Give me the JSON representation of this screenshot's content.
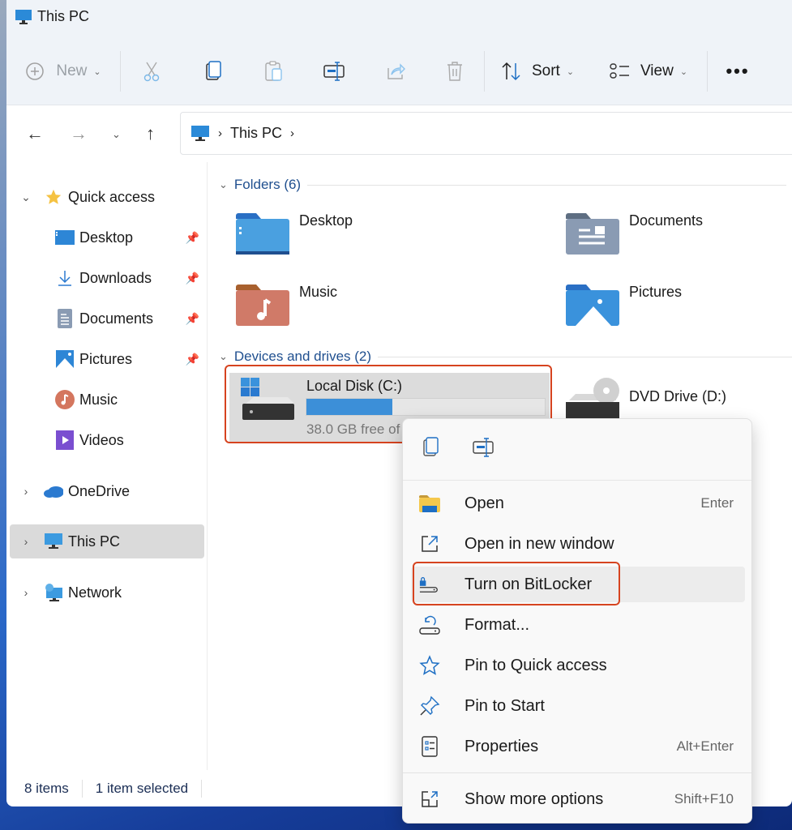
{
  "window": {
    "title": "This PC"
  },
  "toolbar": {
    "new_label": "New",
    "sort_label": "Sort",
    "view_label": "View",
    "icons": [
      "plus-circle-icon",
      "cut-icon",
      "copy-icon",
      "paste-icon",
      "rename-icon",
      "share-icon",
      "delete-icon",
      "sort-icon",
      "view-icon",
      "more-icon"
    ]
  },
  "nav": {
    "breadcrumb": [
      "This PC"
    ]
  },
  "sidebar": {
    "quick_access": "Quick access",
    "items": [
      {
        "label": "Desktop",
        "pinned": true
      },
      {
        "label": "Downloads",
        "pinned": true
      },
      {
        "label": "Documents",
        "pinned": true
      },
      {
        "label": "Pictures",
        "pinned": true
      },
      {
        "label": "Music",
        "pinned": false
      },
      {
        "label": "Videos",
        "pinned": false
      }
    ],
    "onedrive": "OneDrive",
    "this_pc": "This PC",
    "network": "Network"
  },
  "content": {
    "folders_header": "Folders (6)",
    "folders": [
      {
        "label": "Desktop"
      },
      {
        "label": "Documents"
      },
      {
        "label": "Music"
      },
      {
        "label": "Pictures"
      }
    ],
    "devices_header": "Devices and drives (2)",
    "drives": [
      {
        "label": "Local Disk (C:)",
        "free_text": "38.0 GB free of",
        "used_fraction": 0.36
      },
      {
        "label": "DVD Drive (D:)"
      }
    ]
  },
  "status": {
    "items": "8 items",
    "selected": "1 item selected"
  },
  "context_menu": {
    "top_icons": [
      "copy-icon",
      "rename-icon"
    ],
    "items": [
      {
        "label": "Open",
        "shortcut": "Enter"
      },
      {
        "label": "Open in new window",
        "shortcut": ""
      },
      {
        "label": "Turn on BitLocker",
        "shortcut": ""
      },
      {
        "label": "Format...",
        "shortcut": ""
      },
      {
        "label": "Pin to Quick access",
        "shortcut": ""
      },
      {
        "label": "Pin to Start",
        "shortcut": ""
      },
      {
        "label": "Properties",
        "shortcut": "Alt+Enter"
      },
      {
        "label": "Show more options",
        "shortcut": "Shift+F10"
      }
    ]
  },
  "colors": {
    "accent": "#0067c0",
    "highlight_box": "#d6431f",
    "progress": "#3c8fd8"
  }
}
